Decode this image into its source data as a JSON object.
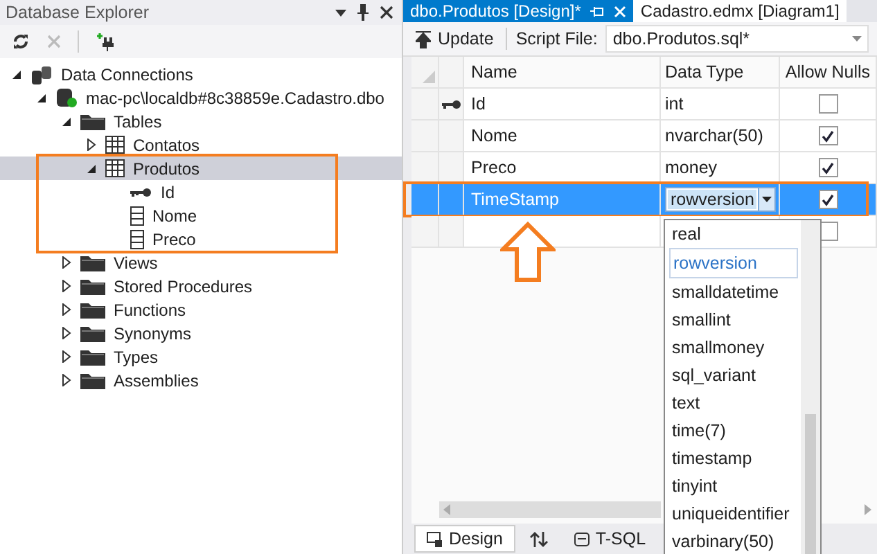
{
  "explorer": {
    "title": "Database Explorer",
    "tree": [
      {
        "label": "Data Connections",
        "kind": "connections",
        "expanded": true,
        "selected": false,
        "children": [
          {
            "label": "mac-pc\\localdb#8c38859e.Cadastro.dbo",
            "kind": "database",
            "expanded": true,
            "selected": false,
            "children": [
              {
                "label": "Tables",
                "kind": "folder",
                "expanded": true,
                "selected": false,
                "children": [
                  {
                    "label": "Contatos",
                    "kind": "table",
                    "expanded": false,
                    "selected": false
                  },
                  {
                    "label": "Produtos",
                    "kind": "table",
                    "expanded": true,
                    "selected": true,
                    "children": [
                      {
                        "label": "Id",
                        "kind": "key",
                        "selected": false
                      },
                      {
                        "label": "Nome",
                        "kind": "column",
                        "selected": false
                      },
                      {
                        "label": "Preco",
                        "kind": "column",
                        "selected": false
                      }
                    ]
                  }
                ]
              },
              {
                "label": "Views",
                "kind": "folder",
                "expanded": false,
                "selected": false
              },
              {
                "label": "Stored Procedures",
                "kind": "folder",
                "expanded": false,
                "selected": false
              },
              {
                "label": "Functions",
                "kind": "folder",
                "expanded": false,
                "selected": false
              },
              {
                "label": "Synonyms",
                "kind": "folder",
                "expanded": false,
                "selected": false
              },
              {
                "label": "Types",
                "kind": "folder",
                "expanded": false,
                "selected": false
              },
              {
                "label": "Assemblies",
                "kind": "folder",
                "expanded": false,
                "selected": false
              }
            ]
          }
        ]
      }
    ]
  },
  "tabs": [
    {
      "label": "dbo.Produtos [Design]*",
      "selected": true
    },
    {
      "label": "Cadastro.edmx [Diagram1]",
      "selected": false
    }
  ],
  "toolbar": {
    "update": "Update",
    "script_label": "Script File:",
    "script_file": "dbo.Produtos.sql*"
  },
  "table": {
    "columns": [
      "Name",
      "Data Type",
      "Allow Nulls"
    ],
    "rows": [
      {
        "name": "Id",
        "type": "int",
        "allow_nulls": false,
        "primary_key": true,
        "selected": false,
        "editing": false
      },
      {
        "name": "Nome",
        "type": "nvarchar(50)",
        "allow_nulls": true,
        "primary_key": false,
        "selected": false,
        "editing": false
      },
      {
        "name": "Preco",
        "type": "money",
        "allow_nulls": true,
        "primary_key": false,
        "selected": false,
        "editing": false
      },
      {
        "name": "TimeStamp",
        "type": "rowversion",
        "allow_nulls": true,
        "primary_key": false,
        "selected": true,
        "editing": true
      }
    ],
    "new_row": {
      "allow_nulls": false
    }
  },
  "type_dropdown": {
    "items": [
      {
        "label": "real",
        "selected": false
      },
      {
        "label": "rowversion",
        "selected": true
      },
      {
        "label": "smalldatetime",
        "selected": false
      },
      {
        "label": "smallint",
        "selected": false
      },
      {
        "label": "smallmoney",
        "selected": false
      },
      {
        "label": "sql_variant",
        "selected": false
      },
      {
        "label": "text",
        "selected": false
      },
      {
        "label": "time(7)",
        "selected": false
      },
      {
        "label": "timestamp",
        "selected": false
      },
      {
        "label": "tinyint",
        "selected": false
      },
      {
        "label": "uniqueidentifier",
        "selected": false
      },
      {
        "label": "varbinary(50)",
        "selected": false
      }
    ]
  },
  "bottom_tabs": [
    {
      "label": "Design",
      "selected": true
    },
    {
      "label": "T-SQL",
      "selected": false
    }
  ]
}
